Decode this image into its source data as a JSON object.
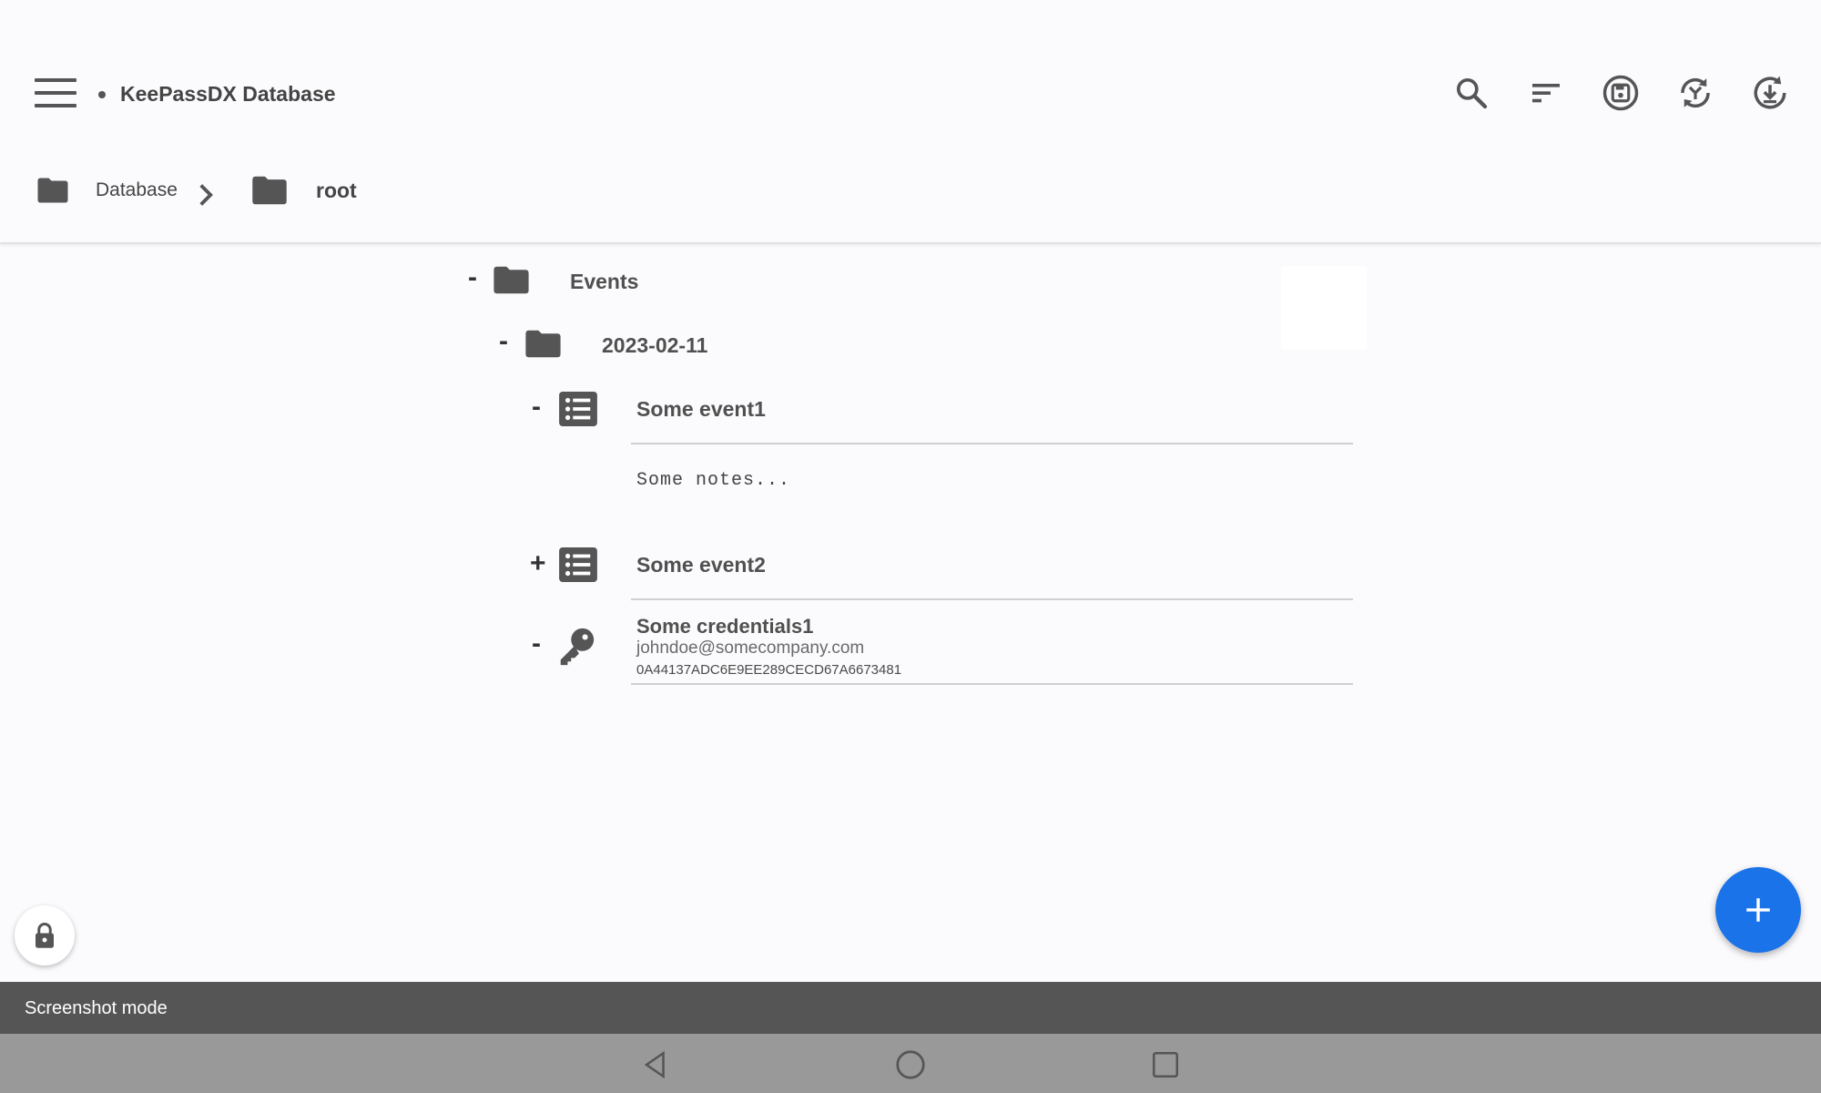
{
  "app": {
    "title": "KeePassDX Database"
  },
  "toolbar": {
    "icons": [
      "menu-icon",
      "search-icon",
      "sort-icon",
      "save-icon",
      "merge-icon",
      "reload-icon"
    ]
  },
  "breadcrumb": {
    "items": [
      {
        "label": "Database"
      },
      {
        "label": "root"
      }
    ]
  },
  "tree": {
    "events": {
      "toggle": "-",
      "label": "Events"
    },
    "date_group": {
      "toggle": "-",
      "label": "2023-02-11"
    },
    "event1": {
      "toggle": "-",
      "label": "Some event1",
      "notes": "Some notes..."
    },
    "event2": {
      "toggle": "+",
      "label": "Some event2"
    },
    "credentials1": {
      "toggle": "-",
      "label": "Some credentials1",
      "username": "johndoe@somecompany.com",
      "value": "0A44137ADC6E9EE289CECD67A6673481"
    }
  },
  "snackbar": {
    "text": "Screenshot mode"
  },
  "colors": {
    "fab": "#1a73e8",
    "icon": "#555555",
    "snackbar": "#555555",
    "nav_bar": "#999999"
  }
}
